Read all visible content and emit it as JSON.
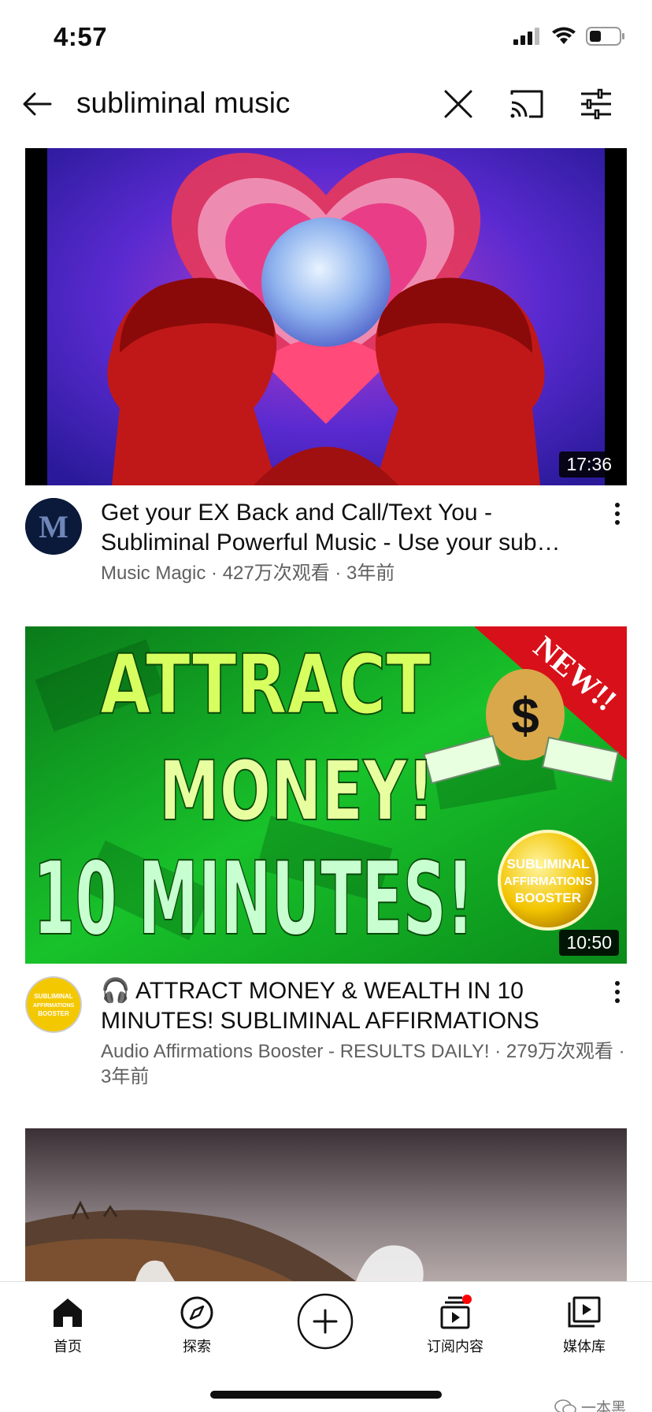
{
  "status_bar": {
    "time": "4:57"
  },
  "search": {
    "query": "subliminal music"
  },
  "videos": [
    {
      "duration": "17:36",
      "title": "Get your EX Back and Call/Text You - Subliminal Powerful Music - Use your sub…",
      "meta": "Music Magic · 427万次观看 · 3年前",
      "avatar_letter": "M"
    },
    {
      "duration": "10:50",
      "title": "🎧 ATTRACT MONEY & WEALTH IN 10 MINUTES! SUBLIMINAL AFFIRMATIONS B…",
      "meta": "Audio Affirmations Booster - RESULTS DAILY! · 279万次观看 · 3年前",
      "thumb_text": {
        "line1": "ATTRACT",
        "line2": "MONEY!",
        "line3": "10 MINUTES!",
        "ribbon": "NEW!!",
        "badge_line1": "SUBLIMINAL",
        "badge_line2": "AFFIRMATIONS",
        "badge_line3": "BOOSTER"
      },
      "avatar_lines": [
        "SUBLIMINAL",
        "AFFIRMATIONS",
        "BOOSTER"
      ]
    },
    {
      "duration": ""
    }
  ],
  "bottom_nav": {
    "home": "首页",
    "explore": "探索",
    "subscriptions": "订阅内容",
    "library": "媒体库"
  },
  "watermark": "一本黑",
  "colors": {
    "accent_red": "#ff0000",
    "meta_gray": "#606060"
  }
}
